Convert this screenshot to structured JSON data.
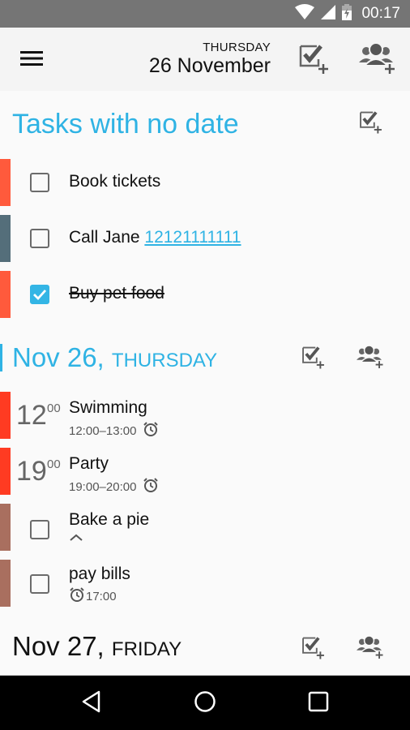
{
  "status_bar": {
    "time": "00:17",
    "icons": [
      "wifi-icon",
      "cell-signal-icon",
      "battery-charging-icon"
    ]
  },
  "app_bar": {
    "menu_icon": "hamburger-menu-icon",
    "weekday": "THURSDAY",
    "date": "26 November",
    "actions": [
      {
        "name": "add-task",
        "icon": "task-add-icon"
      },
      {
        "name": "add-event",
        "icon": "group-add-icon"
      }
    ]
  },
  "sections": {
    "no_date": {
      "title": "Tasks with no date",
      "tasks": [
        {
          "text": "Book tickets",
          "done": false,
          "color": "#ff5a3c"
        },
        {
          "text": "Call Jane ",
          "link": "12121111111",
          "done": false,
          "color": "#546e7a"
        },
        {
          "text": "Buy pet food",
          "done": true,
          "color": "#ff5a3c"
        }
      ]
    },
    "nov26": {
      "date": "Nov 26,",
      "weekday": "THURSDAY",
      "events": [
        {
          "hour": "12",
          "minutes": "00",
          "title": "Swimming",
          "range": "12:00–13:00",
          "color": "#ff3b22"
        },
        {
          "hour": "19",
          "minutes": "00",
          "title": "Party",
          "range": "19:00–20:00",
          "color": "#ff3b22"
        }
      ],
      "tasks": [
        {
          "text": "Bake a pie",
          "done": false,
          "color": "#a96f5f",
          "sub_icon": "chevron-up-icon"
        },
        {
          "text": "pay bills",
          "done": false,
          "color": "#a96f5f",
          "reminder": "17:00"
        }
      ]
    },
    "nov27": {
      "date": "Nov 27,",
      "weekday": "FRIDAY"
    }
  },
  "colors": {
    "accent": "#2fb3e4",
    "checkbox_checked": "#33b5e5",
    "status_bar": "#757575",
    "app_bar": "#f4f4f4"
  },
  "nav_bar": {
    "buttons": [
      "back-icon",
      "home-icon",
      "recents-icon"
    ]
  }
}
